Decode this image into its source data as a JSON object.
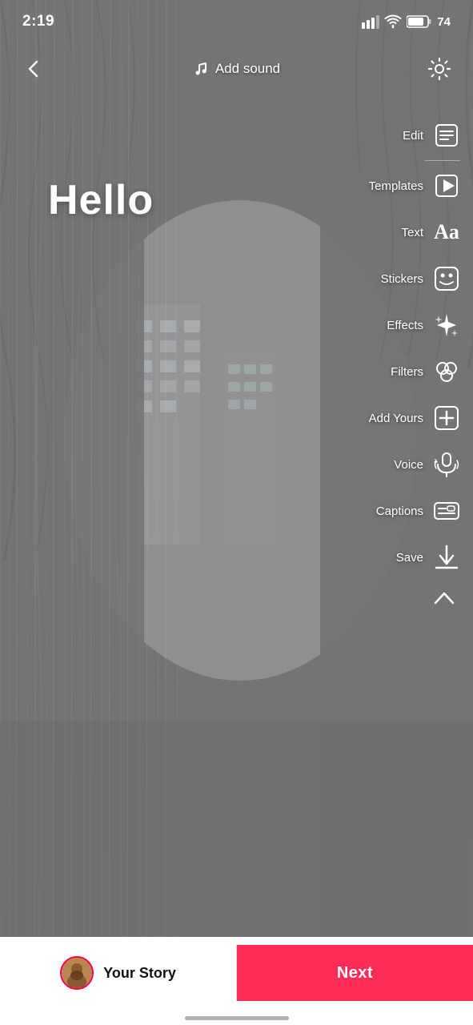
{
  "statusBar": {
    "time": "2:19",
    "battery": "74"
  },
  "header": {
    "addSoundLabel": "Add sound",
    "backAriaLabel": "back"
  },
  "content": {
    "helloText": "Hello"
  },
  "toolbar": {
    "items": [
      {
        "id": "edit",
        "label": "Edit",
        "icon": "edit-icon"
      },
      {
        "id": "templates",
        "label": "Templates",
        "icon": "templates-icon"
      },
      {
        "id": "text",
        "label": "Text",
        "icon": "text-icon"
      },
      {
        "id": "stickers",
        "label": "Stickers",
        "icon": "stickers-icon"
      },
      {
        "id": "effects",
        "label": "Effects",
        "icon": "effects-icon"
      },
      {
        "id": "filters",
        "label": "Filters",
        "icon": "filters-icon"
      },
      {
        "id": "add-yours",
        "label": "Add Yours",
        "icon": "add-yours-icon"
      },
      {
        "id": "voice",
        "label": "Voice",
        "icon": "voice-icon"
      },
      {
        "id": "captions",
        "label": "Captions",
        "icon": "captions-icon"
      },
      {
        "id": "save",
        "label": "Save",
        "icon": "save-icon"
      }
    ]
  },
  "bottomBar": {
    "yourStoryLabel": "Your Story",
    "nextLabel": "Next"
  }
}
